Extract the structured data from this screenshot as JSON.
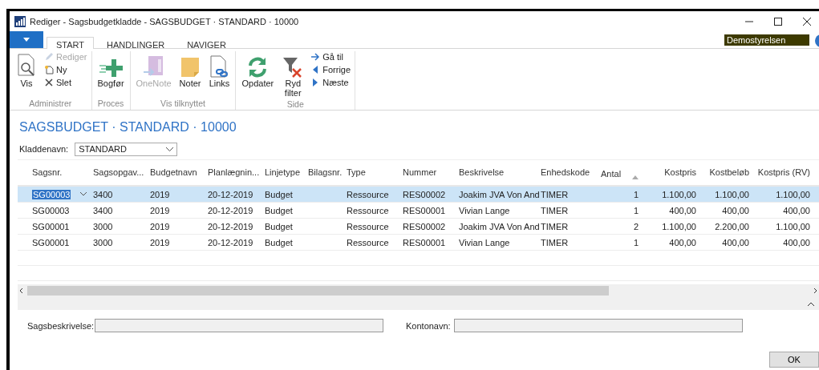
{
  "window": {
    "title": "Rediger - Sagsbudgetkladde - SAGSBUDGET · STANDARD · 10000"
  },
  "tabs": [
    {
      "label": "START",
      "selected": true
    },
    {
      "label": "HANDLINGER",
      "selected": false
    },
    {
      "label": "NAVIGER",
      "selected": false
    }
  ],
  "company": "Demostyrelsen",
  "ribbon": [
    {
      "label": "Administrer",
      "items": [
        {
          "label": "Vis",
          "kind": "large",
          "disabled": false
        },
        {
          "label": "Rediger",
          "kind": "small",
          "disabled": true
        },
        {
          "label": "Ny",
          "kind": "small",
          "disabled": false
        },
        {
          "label": "Slet",
          "kind": "small",
          "disabled": false
        }
      ]
    },
    {
      "label": "Proces",
      "items": [
        {
          "label": "Bogfør",
          "kind": "large",
          "disabled": false
        }
      ]
    },
    {
      "label": "Vis tilknyttet",
      "items": [
        {
          "label": "OneNote",
          "kind": "large",
          "disabled": true
        },
        {
          "label": "Noter",
          "kind": "large",
          "disabled": false
        },
        {
          "label": "Links",
          "kind": "large",
          "disabled": false
        }
      ]
    },
    {
      "label": "Side",
      "items": [
        {
          "label": "Opdater",
          "kind": "large",
          "disabled": false
        },
        {
          "label": "Ryd filter",
          "kind": "large",
          "disabled": false
        },
        {
          "label": "Gå til",
          "kind": "small",
          "disabled": false
        },
        {
          "label": "Forrige",
          "kind": "small",
          "disabled": false
        },
        {
          "label": "Næste",
          "kind": "small",
          "disabled": false
        }
      ]
    }
  ],
  "page_title": "SAGSBUDGET · STANDARD · 10000",
  "journal": {
    "label": "Kladdenavn:",
    "value": "STANDARD"
  },
  "table": {
    "columns": [
      {
        "label": "Sagsnr.",
        "sorted": false
      },
      {
        "label": "Sagsopgav...",
        "sorted": false
      },
      {
        "label": "Budgetnavn",
        "sorted": false
      },
      {
        "label": "Planlægnin...",
        "sorted": false
      },
      {
        "label": "Linjetype",
        "sorted": false
      },
      {
        "label": "Bilagsnr.",
        "sorted": false
      },
      {
        "label": "Type",
        "sorted": false
      },
      {
        "label": "Nummer",
        "sorted": false
      },
      {
        "label": "Beskrivelse",
        "sorted": false
      },
      {
        "label": "Enhedskode",
        "sorted": false
      },
      {
        "label": "Antal",
        "sorted": true
      },
      {
        "label": "Kostpris",
        "sorted": false
      },
      {
        "label": "Kostbeløb",
        "sorted": false
      },
      {
        "label": "Kostpris (RV)",
        "sorted": false
      }
    ],
    "rows": [
      {
        "selected": true,
        "cells": [
          "SG00003",
          "3400",
          "2019",
          "20-12-2019",
          "Budget",
          "",
          "Ressource",
          "RES00002",
          "Joakim JVA Von And",
          "TIMER",
          "1",
          "1.100,00",
          "1.100,00",
          "1.100,00"
        ]
      },
      {
        "selected": false,
        "cells": [
          "SG00003",
          "3400",
          "2019",
          "20-12-2019",
          "Budget",
          "",
          "Ressource",
          "RES00001",
          "Vivian Lange",
          "TIMER",
          "1",
          "400,00",
          "400,00",
          "400,00"
        ]
      },
      {
        "selected": false,
        "cells": [
          "SG00001",
          "3000",
          "2019",
          "20-12-2019",
          "Budget",
          "",
          "Ressource",
          "RES00002",
          "Joakim JVA Von And",
          "TIMER",
          "2",
          "1.100,00",
          "2.200,00",
          "1.100,00"
        ]
      },
      {
        "selected": false,
        "cells": [
          "SG00001",
          "3000",
          "2019",
          "20-12-2019",
          "Budget",
          "",
          "Ressource",
          "RES00001",
          "Vivian Lange",
          "TIMER",
          "1",
          "400,00",
          "400,00",
          "400,00"
        ]
      }
    ]
  },
  "fields": [
    {
      "label": "Sagsbeskrivelse:",
      "disabled": true
    },
    {
      "label": "Kontonavn:",
      "disabled": true
    }
  ],
  "buttons": [
    "OK"
  ]
}
